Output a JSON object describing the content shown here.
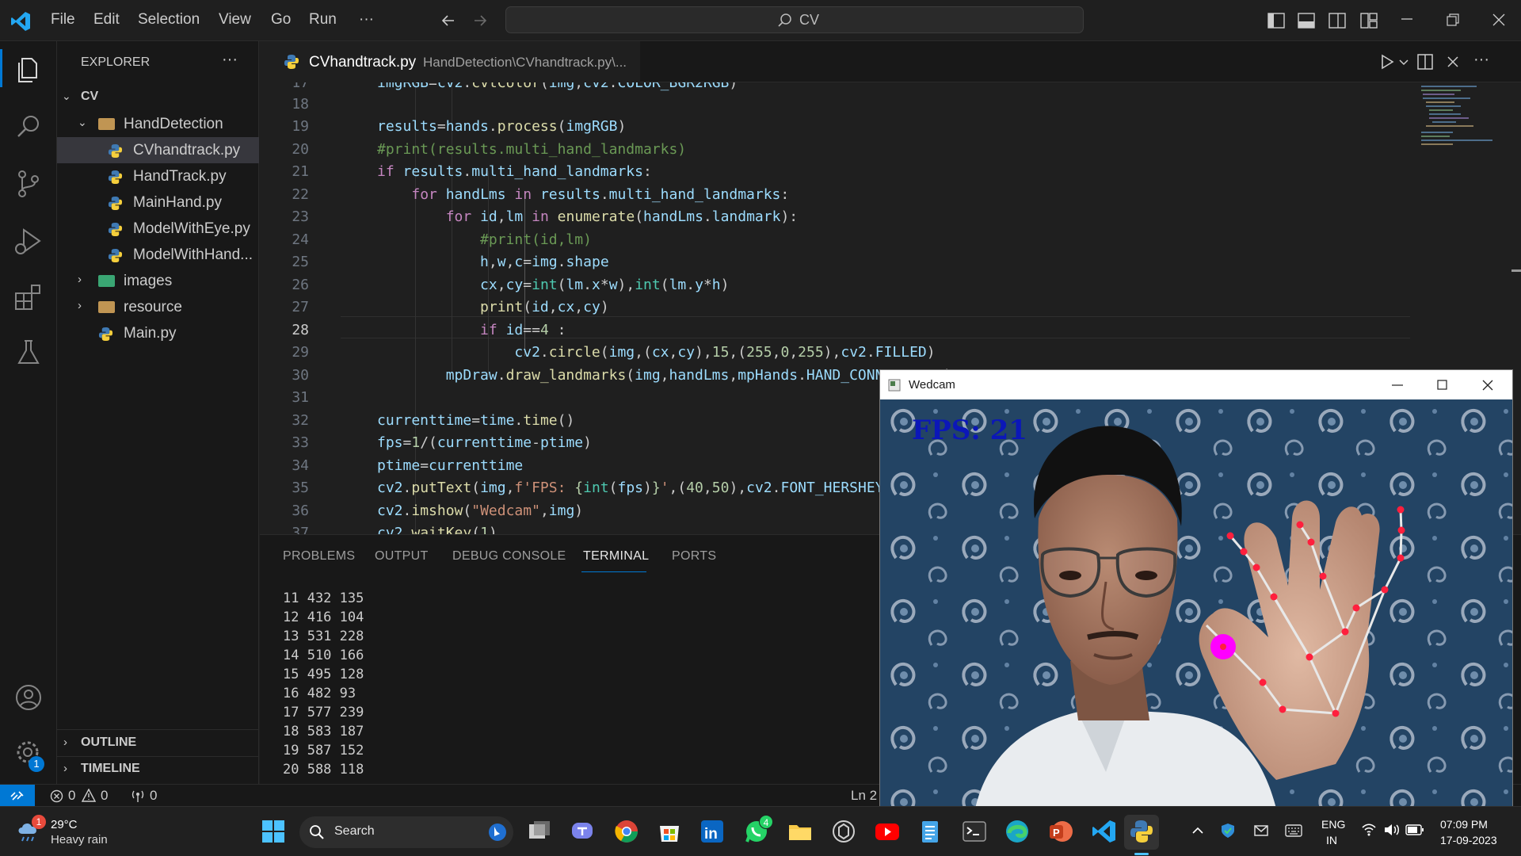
{
  "titlebar": {
    "menu": [
      "File",
      "Edit",
      "Selection",
      "View",
      "Go",
      "Run",
      "···"
    ],
    "search": "CV"
  },
  "explorer": {
    "title": "EXPLORER",
    "more": "···",
    "root": "CV",
    "folder": "HandDetection",
    "files": [
      "CVhandtrack.py",
      "HandTrack.py",
      "MainHand.py",
      "ModelWithEye.py",
      "ModelWithHand..."
    ],
    "subfolders": [
      "images",
      "resource"
    ],
    "main_file": "Main.py",
    "outline": "OUTLINE",
    "timeline": "TIMELINE",
    "settings_badge": "1"
  },
  "tab": {
    "name": "CVhandtrack.py",
    "path": "HandDetection\\CVhandtrack.py\\..."
  },
  "editor": {
    "line_numbers": [
      "17",
      "18",
      "19",
      "20",
      "21",
      "22",
      "23",
      "24",
      "25",
      "26",
      "27",
      "28",
      "29",
      "30",
      "31",
      "32",
      "33",
      "34",
      "35",
      "36",
      "37"
    ]
  },
  "panel": {
    "tabs": [
      "PROBLEMS",
      "OUTPUT",
      "DEBUG CONSOLE",
      "TERMINAL",
      "PORTS"
    ],
    "active_tab": "TERMINAL",
    "terminal_lines": [
      "11 432 135",
      "12 416 104",
      "13 531 228",
      "14 510 166",
      "15 495 128",
      "16 482 93",
      "17 577 239",
      "18 583 187",
      "19 587 152",
      "20 588 118"
    ]
  },
  "statusbar": {
    "errors": "0",
    "warnings": "0",
    "ports": "0",
    "position": "Ln 2"
  },
  "window": {
    "title": "Wedcam",
    "overlay": "FPS: 21"
  },
  "taskbar": {
    "temperature": "29°C",
    "weather": "Heavy rain",
    "weather_badge": "1",
    "search": "Search",
    "whatsapp_badge": "4",
    "lang1": "ENG",
    "lang2": "IN",
    "time": "07:09 PM",
    "date": "17-09-2023"
  },
  "colors": {
    "accent": "#0078d4",
    "vscode_blue": "#23a7f2",
    "landmark": "#ff1f3d",
    "thumb_tip": "#ff00ff",
    "fps_text": "#0b17b8"
  }
}
